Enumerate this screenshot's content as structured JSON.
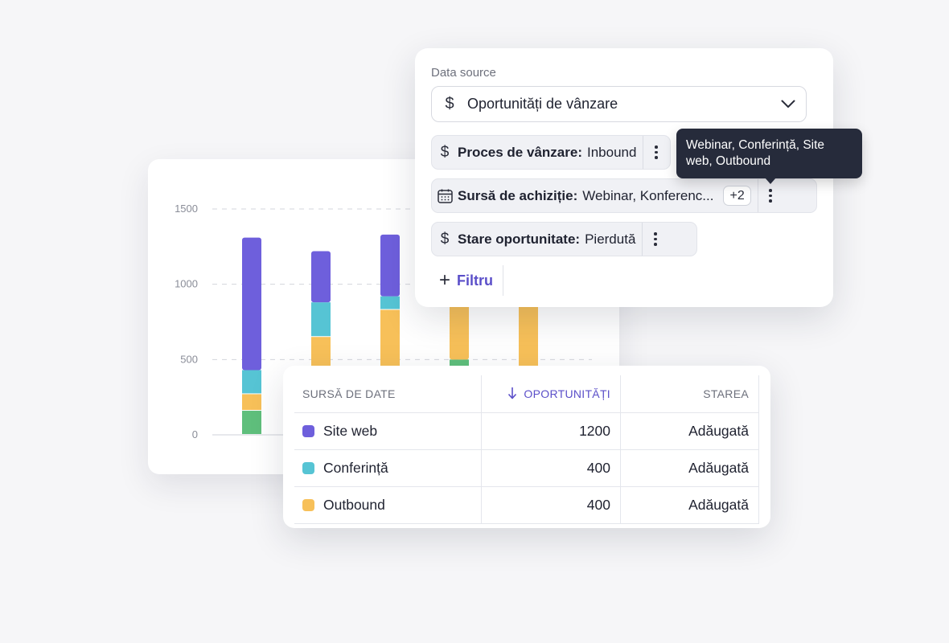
{
  "chart_data": {
    "type": "bar",
    "stacked": true,
    "y_ticks": [
      "1500",
      "1000",
      "500",
      "0"
    ],
    "ylim": [
      0,
      1500
    ],
    "grid": true,
    "categories_count": 5,
    "series": [
      {
        "color": "#5fbf7c",
        "values": [
          160,
          0,
          0,
          0,
          0
        ]
      },
      {
        "color": "#f7c059",
        "values": [
          110,
          0,
          0,
          0,
          0
        ]
      },
      {
        "color": "#56c4d4",
        "values": [
          160,
          0,
          0,
          0,
          0
        ]
      },
      {
        "color": "#6e5fdc",
        "values": [
          880,
          0,
          0,
          0,
          0
        ]
      }
    ],
    "bars": [
      [
        {
          "color": "#5fbf7c",
          "value": 160
        },
        {
          "color": "#f7c059",
          "value": 110
        },
        {
          "color": "#56c4d4",
          "value": 160
        },
        {
          "color": "#6e5fdc",
          "value": 880
        }
      ],
      [
        {
          "color": "#f7c059",
          "value": 650
        },
        {
          "color": "#56c4d4",
          "value": 230
        },
        {
          "color": "#6e5fdc",
          "value": 340
        }
      ],
      [
        {
          "color": "#f7c059",
          "value": 830
        },
        {
          "color": "#56c4d4",
          "value": 90
        },
        {
          "color": "#6e5fdc",
          "value": 410
        }
      ],
      [
        {
          "color": "#5fbf7c",
          "value": 500
        },
        {
          "color": "#f7c059",
          "value": 1000
        }
      ],
      [
        {
          "color": "#f7c059",
          "value": 1500
        }
      ]
    ]
  },
  "filters": {
    "data_source_label": "Data source",
    "data_source_value": "Oportunități de vânzare",
    "chips": [
      {
        "field": "Proces de vânzare",
        "value": "Inbound"
      },
      {
        "field": "Sursă de achiziție",
        "value": "Webinar, Konferenc...",
        "badge": "+2"
      },
      {
        "field": "Stare oportunitate",
        "value": "Pierdută"
      }
    ],
    "add_filter_label": "Filtru",
    "tooltip": "Webinar, Conferință, Site web, Outbound"
  },
  "table": {
    "headers": {
      "source": "SURSĂ DE DATE",
      "opportunities": "OPORTUNITĂȚI",
      "status": "STAREA"
    },
    "rows": [
      {
        "source": "Site web",
        "color": "#6e5fdc",
        "value": "1200",
        "status": "Adăugată"
      },
      {
        "source": "Conferință",
        "color": "#56c4d4",
        "value": "400",
        "status": "Adăugată"
      },
      {
        "source": "Outbound",
        "color": "#f7c059",
        "value": "400",
        "status": "Adăugată"
      }
    ]
  }
}
